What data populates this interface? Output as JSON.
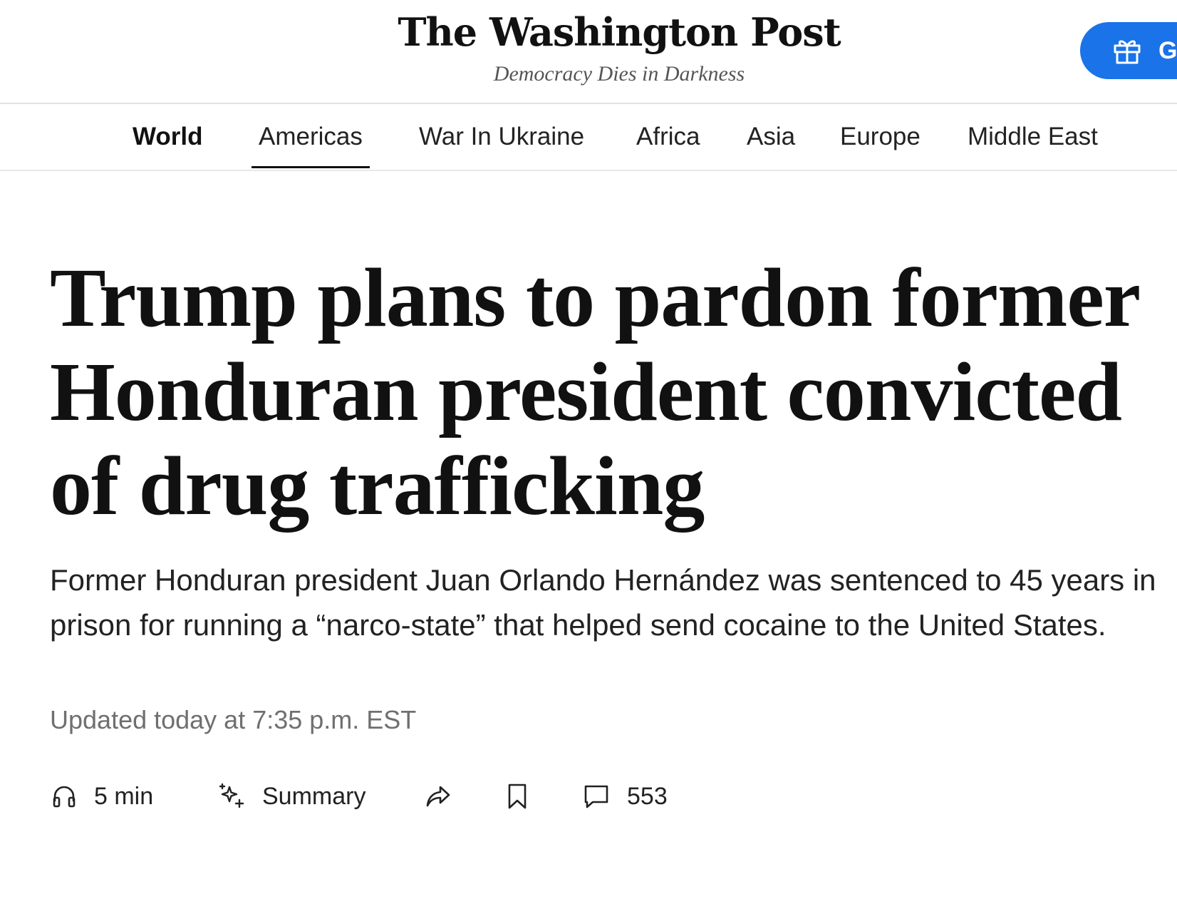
{
  "header": {
    "logo_text": "The Washington Post",
    "tagline": "Democracy Dies in Darkness",
    "gift_button_label": "G",
    "accent_color": "#1a73e8"
  },
  "nav": {
    "items": [
      {
        "label": "World",
        "bold": true
      },
      {
        "label": "Americas",
        "active": true
      },
      {
        "label": "War In Ukraine"
      },
      {
        "label": "Africa"
      },
      {
        "label": "Asia"
      },
      {
        "label": "Europe"
      },
      {
        "label": "Middle East"
      }
    ]
  },
  "article": {
    "headline": "Trump plans to pardon former Honduran president convicted of drug trafficking",
    "dek": "Former Honduran president Juan Orlando Hernández was sentenced to 45 years in prison for running a “narco-state” that helped send cocaine to the United States.",
    "timestamp": "Updated today at 7:35 p.m. EST"
  },
  "toolbar": {
    "listen_label": "5 min",
    "summary_label": "Summary",
    "comments_count": "553",
    "icons": [
      "headphones-icon",
      "sparkle-icon",
      "share-icon",
      "bookmark-icon",
      "comment-icon"
    ]
  }
}
